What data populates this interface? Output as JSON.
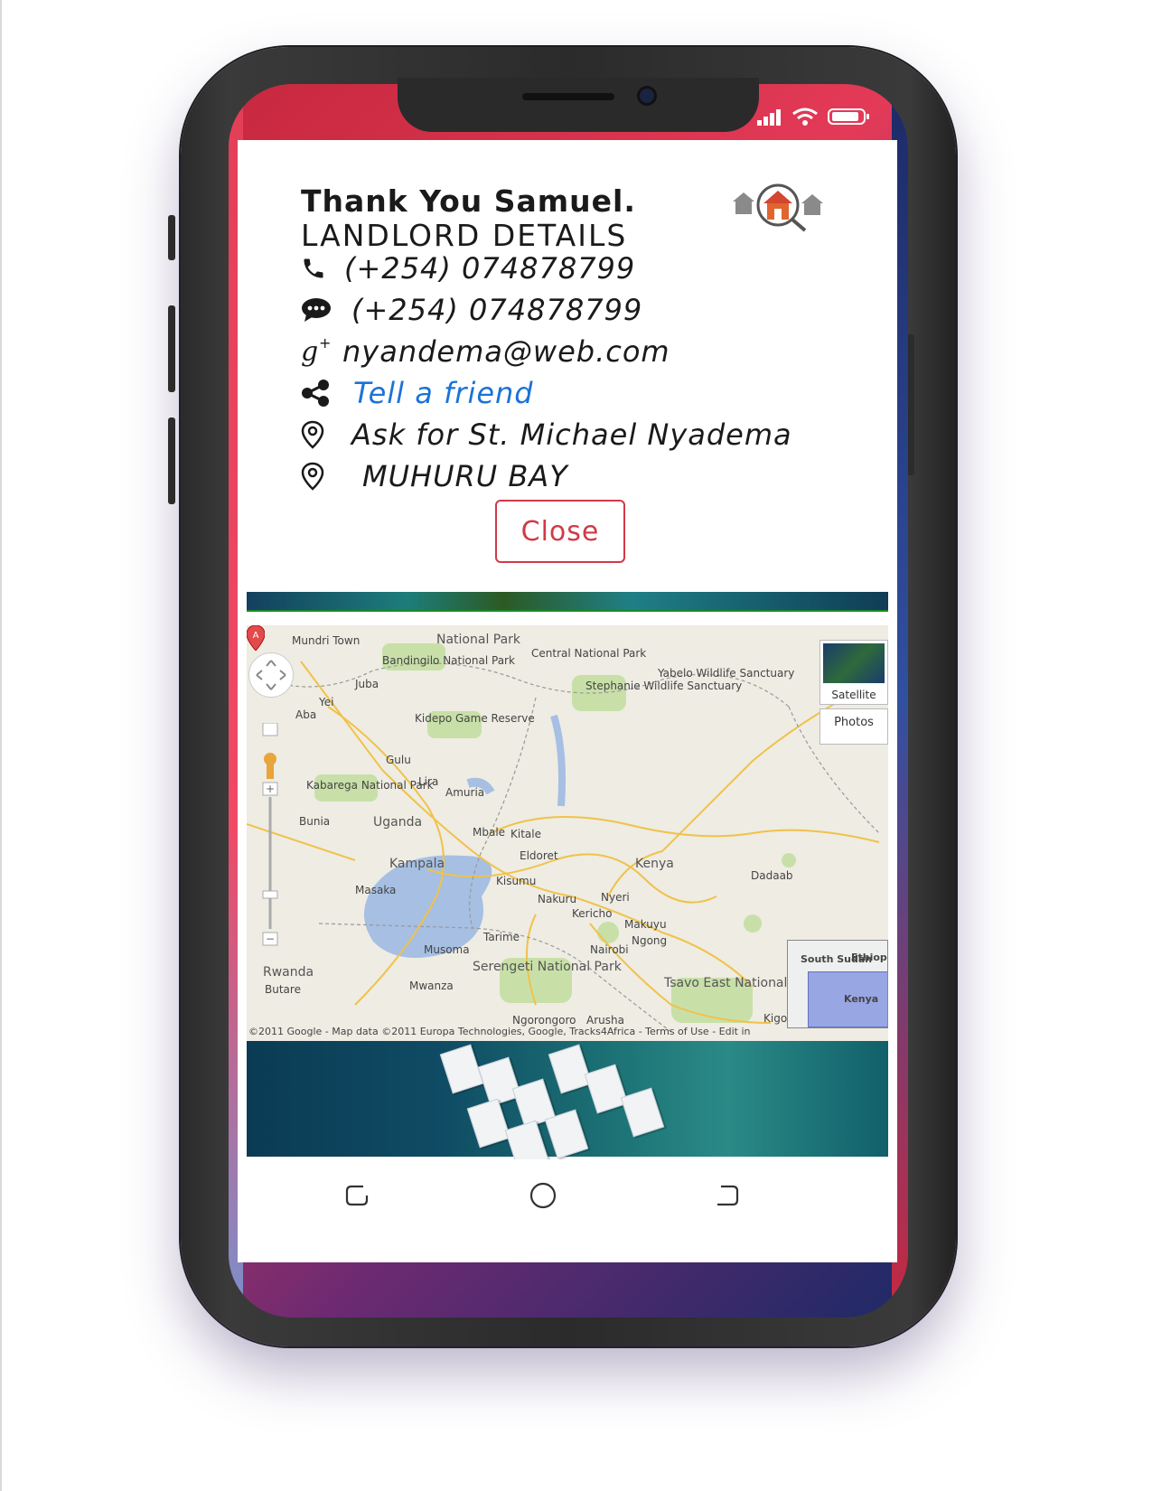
{
  "card": {
    "thank_you": "Thank You Samuel.",
    "heading": "LANDLORD DETAILS",
    "phone": "(+254) 074878799",
    "sms": "(+254) 074878799",
    "email": "nyandema@web.com",
    "share": "Tell a friend",
    "contact_person": "Ask for St. Michael Nyadema",
    "location": "MUHURU BAY",
    "close_label": "Close"
  },
  "map": {
    "satellite_label": "Satellite",
    "photos_label": "Photos",
    "labels": [
      "Mundri Town",
      "Bandingilo National Park",
      "National Park",
      "Central National Park",
      "Stephanie Wildlife Sanctuary",
      "Yabelo Wildlife Sanctuary",
      "Juba",
      "Yei",
      "Aba",
      "Kidepo Game Reserve",
      "Gulu",
      "Lira",
      "Amuria",
      "Kabarega National Park",
      "Bunia",
      "Uganda",
      "Mbale",
      "Kitale",
      "Kampala",
      "Eldoret",
      "Kenya",
      "Masaka",
      "Kisumu",
      "Nakuru",
      "Nyeri",
      "Dadaab",
      "Kericho",
      "Makuyu",
      "Ngong",
      "Nairobi",
      "Rwanda",
      "Butare",
      "Musoma",
      "Serengeti National Park",
      "Mwanza",
      "Tsavo East National Park",
      "Ngorongoro",
      "Arusha",
      "Kigoma",
      "Tarime"
    ],
    "minimap_labels": [
      "South Sudan",
      "Ethiopi",
      "Kenya"
    ],
    "copyright": "©2011 Google - Map data ©2011 Europa Technologies, Google, Tracks4Africa - Terms of Use - Edit in"
  },
  "icons": {
    "phone": "phone-icon",
    "sms": "chat-icon",
    "email": "google-plus-icon",
    "share": "share-icon",
    "contact": "map-pin-icon",
    "location": "map-pin-icon"
  },
  "colors": {
    "accent": "#d03a47",
    "link": "#1a73d8"
  }
}
